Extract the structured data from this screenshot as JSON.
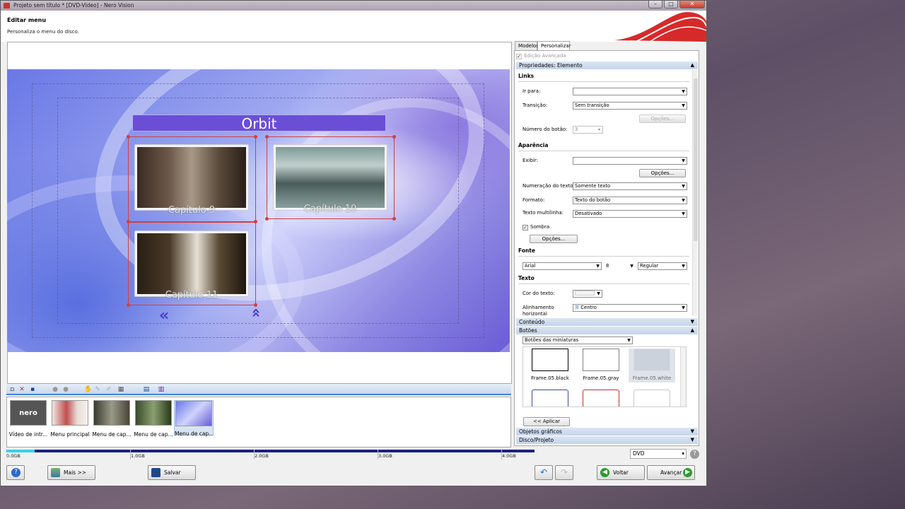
{
  "window": {
    "title": "Projeto sem título * [DVD-Vídeo] - Nero Vision",
    "header_title": "Editar menu",
    "header_subtitle": "Personaliza o menu do disco."
  },
  "menu_preview": {
    "title": "Orbit",
    "buttons": [
      {
        "caption": "Capítulo 9"
      },
      {
        "caption": "Capítulo 10"
      },
      {
        "caption": "Capítulo 11"
      }
    ]
  },
  "timeline": {
    "items": [
      {
        "label": "Vídeo de intr..."
      },
      {
        "label": "Menu principal"
      },
      {
        "label": "Menu de cap..."
      },
      {
        "label": "Menu de cap..."
      },
      {
        "label": "Menu de cap..."
      }
    ]
  },
  "capacity": {
    "ticks": [
      "0.0GB",
      "1.0GB",
      "2.0GB",
      "3.0GB",
      "4.0GB"
    ],
    "used_fraction": 0.97,
    "disc_type": "DVD"
  },
  "bottom": {
    "more_label": "Mais >>",
    "save_label": "Salvar",
    "back_label": "Voltar",
    "next_label": "Avançar"
  },
  "right_panel": {
    "tabs": [
      "Modelos",
      "Personalizar"
    ],
    "advanced_edit": "Edição Avançada",
    "properties_header": "Propriedades: Elemento",
    "groups": {
      "links": "Links",
      "appearance": "Aparência",
      "font": "Fonte",
      "text": "Texto"
    },
    "fields": {
      "go_to_label": "Ir para:",
      "go_to_value": "",
      "transition_label": "Transição:",
      "transition_value": "Sem transição",
      "options_label": "Opções...",
      "button_number_label": "Número do botão:",
      "button_number_value": "3",
      "show_label": "Exibir:",
      "show_value": "",
      "text_numbering_label": "Numeração do texto:",
      "text_numbering_value": "Somente texto",
      "format_label": "Formato:",
      "format_value": "Texto do botão",
      "multiline_label": "Texto multilinha:",
      "multiline_value": "Desativado",
      "shadow_label": "Sombra",
      "font_family": "Arial",
      "font_size": "8",
      "font_style": "Regular",
      "text_color_label": "Cor do texto:",
      "h_align_label": "Alinhamento horizontal",
      "h_align_value": "Centro"
    },
    "sections": {
      "content": "Conteúdo",
      "buttons": "Botões",
      "graphic_objects": "Objetos gráficos",
      "disc_project": "Disco/Projeto"
    },
    "buttons_dropdown": "Botões das miniaturas",
    "frames": [
      {
        "label": "Frame.05.black",
        "color": "#000000"
      },
      {
        "label": "Frame.05.gray",
        "color": "#808080"
      },
      {
        "label": "Frame.05.white",
        "color": "#ffffff"
      },
      {
        "label": "",
        "color": "#3a4a9a"
      },
      {
        "label": "",
        "color": "#c03030"
      },
      {
        "label": "",
        "color": "#c8c8c8"
      }
    ],
    "apply_label": "<< Aplicar"
  }
}
